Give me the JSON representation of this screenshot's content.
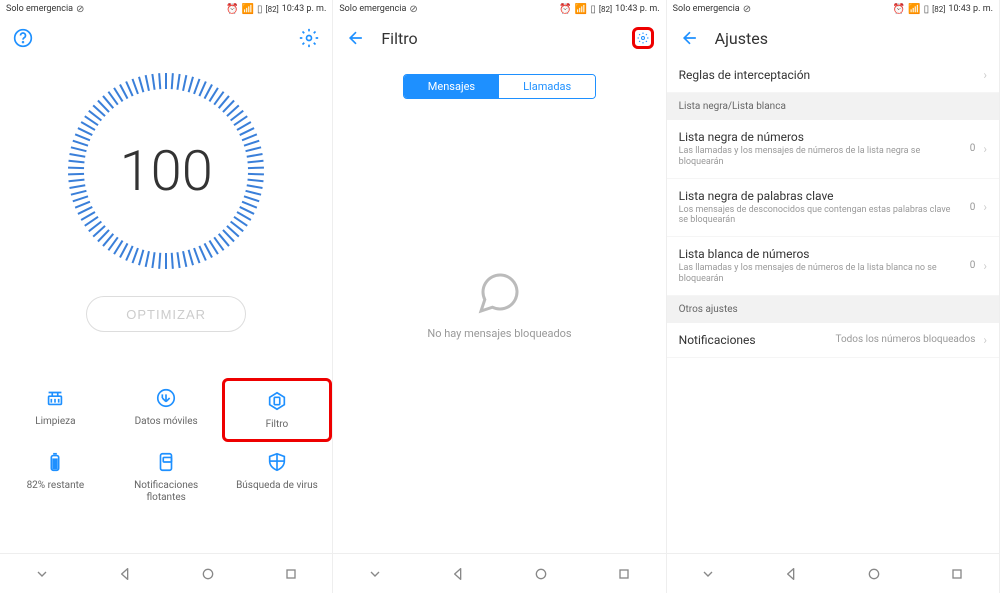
{
  "status": {
    "carrier": "Solo emergencia",
    "battery": "82",
    "time": "10:43 p. m."
  },
  "screen1": {
    "gauge_value": "100",
    "optimize_label": "OPTIMIZAR",
    "grid": [
      {
        "label": "Limpieza"
      },
      {
        "label": "Datos móviles"
      },
      {
        "label": "Filtro"
      },
      {
        "label": "82% restante"
      },
      {
        "label": "Notificaciones flotantes"
      },
      {
        "label": "Búsqueda de virus"
      }
    ]
  },
  "screen2": {
    "title": "Filtro",
    "tab_messages": "Mensajes",
    "tab_calls": "Llamadas",
    "empty_text": "No hay mensajes bloqueados"
  },
  "screen3": {
    "title": "Ajustes",
    "row_rules": "Reglas de interceptación",
    "section_lists": "Lista negra/Lista blanca",
    "rows": [
      {
        "title": "Lista negra de números",
        "sub": "Las llamadas y los mensajes de números de la lista negra se bloquearán",
        "value": "0"
      },
      {
        "title": "Lista negra de palabras clave",
        "sub": "Los mensajes de desconocidos que contengan estas palabras clave se bloquearán",
        "value": "0"
      },
      {
        "title": "Lista blanca de números",
        "sub": "Las llamadas y los mensajes de números de la lista blanca no se bloquearán",
        "value": "0"
      }
    ],
    "section_other": "Otros ajustes",
    "notif_title": "Notificaciones",
    "notif_value": "Todos los números bloqueados"
  }
}
